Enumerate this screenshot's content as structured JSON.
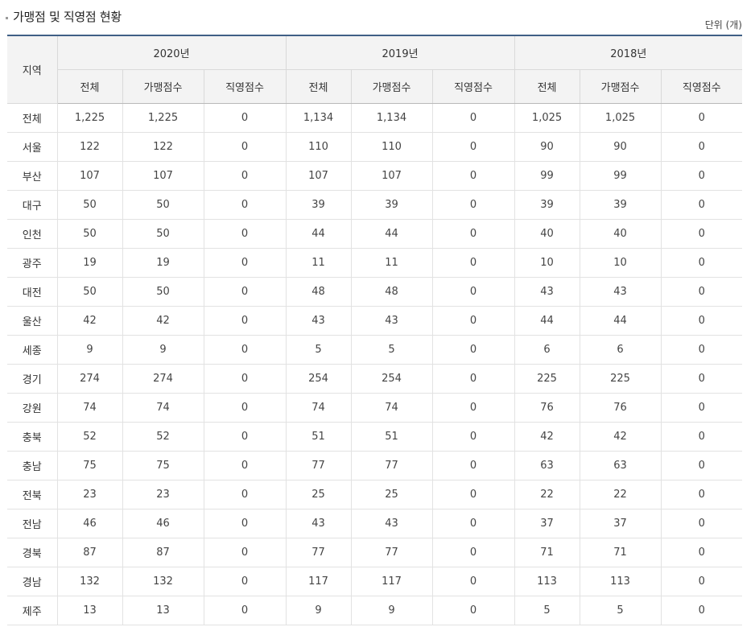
{
  "title": "가맹점 및 직영점 현황",
  "unit": "단위 (개)",
  "header": {
    "region": "지역",
    "years": [
      "2020년",
      "2019년",
      "2018년"
    ],
    "sub": [
      "전체",
      "가맹점수",
      "직영점수"
    ]
  },
  "rows": [
    [
      "전체",
      "1,225",
      "1,225",
      "0",
      "1,134",
      "1,134",
      "0",
      "1,025",
      "1,025",
      "0"
    ],
    [
      "서울",
      "122",
      "122",
      "0",
      "110",
      "110",
      "0",
      "90",
      "90",
      "0"
    ],
    [
      "부산",
      "107",
      "107",
      "0",
      "107",
      "107",
      "0",
      "99",
      "99",
      "0"
    ],
    [
      "대구",
      "50",
      "50",
      "0",
      "39",
      "39",
      "0",
      "39",
      "39",
      "0"
    ],
    [
      "인천",
      "50",
      "50",
      "0",
      "44",
      "44",
      "0",
      "40",
      "40",
      "0"
    ],
    [
      "광주",
      "19",
      "19",
      "0",
      "11",
      "11",
      "0",
      "10",
      "10",
      "0"
    ],
    [
      "대전",
      "50",
      "50",
      "0",
      "48",
      "48",
      "0",
      "43",
      "43",
      "0"
    ],
    [
      "울산",
      "42",
      "42",
      "0",
      "43",
      "43",
      "0",
      "44",
      "44",
      "0"
    ],
    [
      "세종",
      "9",
      "9",
      "0",
      "5",
      "5",
      "0",
      "6",
      "6",
      "0"
    ],
    [
      "경기",
      "274",
      "274",
      "0",
      "254",
      "254",
      "0",
      "225",
      "225",
      "0"
    ],
    [
      "강원",
      "74",
      "74",
      "0",
      "74",
      "74",
      "0",
      "76",
      "76",
      "0"
    ],
    [
      "충북",
      "52",
      "52",
      "0",
      "51",
      "51",
      "0",
      "42",
      "42",
      "0"
    ],
    [
      "충남",
      "75",
      "75",
      "0",
      "77",
      "77",
      "0",
      "63",
      "63",
      "0"
    ],
    [
      "전북",
      "23",
      "23",
      "0",
      "25",
      "25",
      "0",
      "22",
      "22",
      "0"
    ],
    [
      "전남",
      "46",
      "46",
      "0",
      "43",
      "43",
      "0",
      "37",
      "37",
      "0"
    ],
    [
      "경북",
      "87",
      "87",
      "0",
      "77",
      "77",
      "0",
      "71",
      "71",
      "0"
    ],
    [
      "경남",
      "132",
      "132",
      "0",
      "117",
      "117",
      "0",
      "113",
      "113",
      "0"
    ],
    [
      "제주",
      "13",
      "13",
      "0",
      "9",
      "9",
      "0",
      "5",
      "5",
      "0"
    ]
  ]
}
